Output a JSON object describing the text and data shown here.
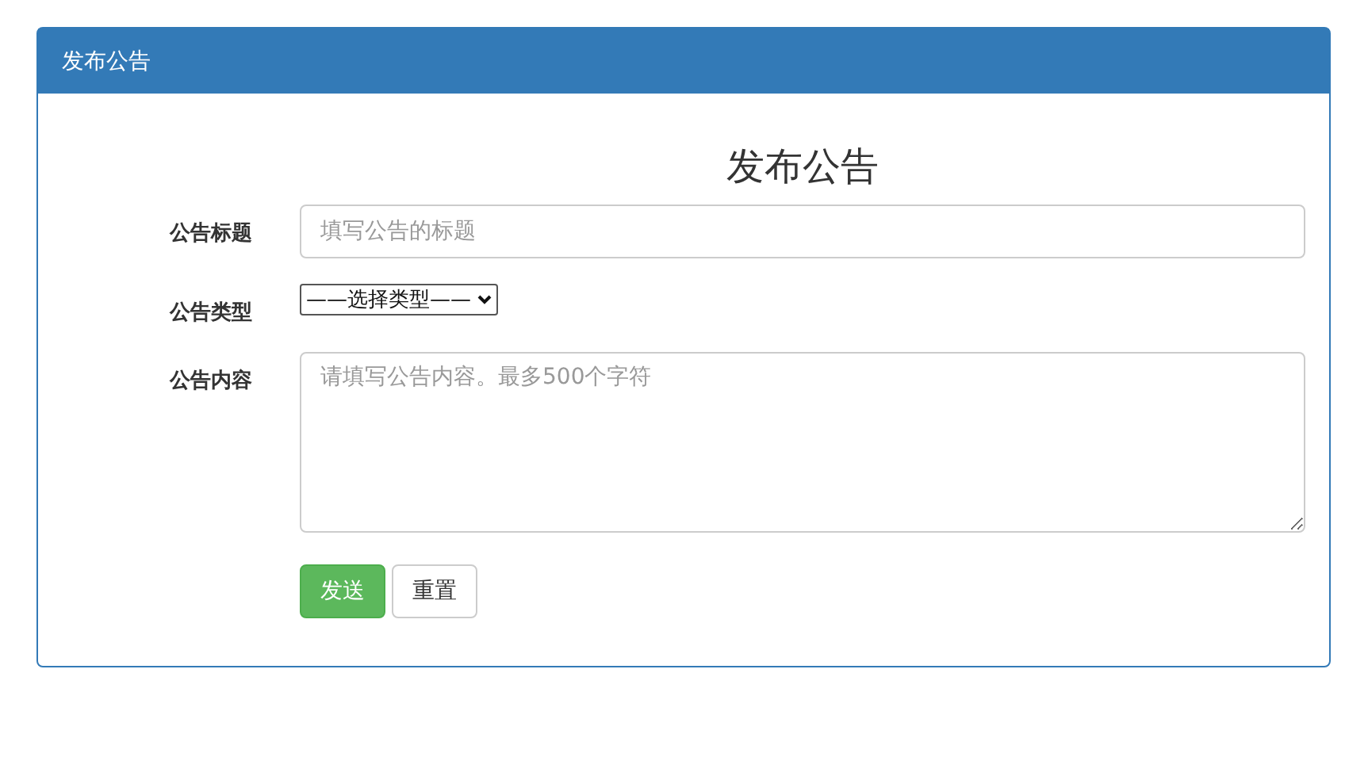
{
  "panel": {
    "title": "发布公告"
  },
  "form": {
    "heading": "发布公告",
    "fields": [
      {
        "kind": "text",
        "label": "公告标题",
        "placeholder": "填写公告的标题"
      },
      {
        "kind": "select",
        "label": "公告类型",
        "value": "——选择类型——"
      },
      {
        "kind": "textarea",
        "label": "公告内容",
        "placeholder": "请填写公告内容。最多500个字符"
      }
    ],
    "buttons": [
      {
        "kind": "primary",
        "label": "发送"
      },
      {
        "kind": "default",
        "label": "重置"
      }
    ]
  }
}
